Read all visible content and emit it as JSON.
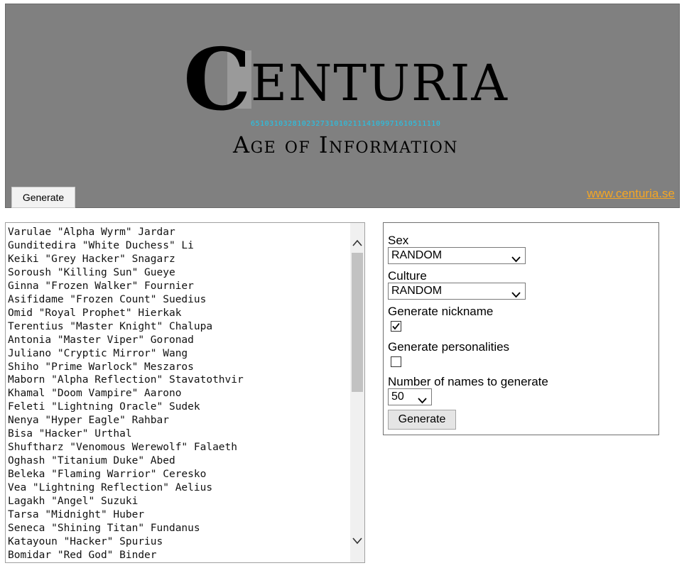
{
  "header": {
    "logo_c": "C",
    "logo_word": "ENTURIA",
    "logo_digits": "65103103281023273101021114109971610511110",
    "subtitle": "Age of Information",
    "generate_label": "Generate",
    "site_link": "www.centuria.se",
    "background": "#808080",
    "link_color": "#f5a623",
    "digits_color": "#1ec8ee"
  },
  "names": [
    "Varulae \"Alpha Wyrm\" Jardar",
    "Gunditedira \"White Duchess\" Li",
    "Keiki \"Grey Hacker\" Snagarz",
    "Soroush \"Killing Sun\" Gueye",
    "Ginna \"Frozen Walker\" Fournier",
    "Asifidame \"Frozen Count\" Suedius",
    "Omid \"Royal Prophet\" Hierkak",
    "Terentius \"Master Knight\" Chalupa",
    "Antonia \"Master Viper\" Goronad",
    "Juliano \"Cryptic Mirror\" Wang",
    "Shiho \"Prime Warlock\" Meszaros",
    "Maborn \"Alpha Reflection\" Stavatothvir",
    "Khamal \"Doom Vampire\" Aarono",
    "Feleti \"Lightning Oracle\" Sudek",
    "Nenya \"Hyper Eagle\" Rahbar",
    "Bisa \"Hacker\" Urthal",
    "Shuftharz \"Venomous Werewolf\" Falaeth",
    "Oghash \"Titanium Duke\" Abed",
    "Beleka \"Flaming Warrior\" Ceresko",
    "Vea \"Lightning Reflection\" Aelius",
    "Lagakh \"Angel\" Suzuki",
    "Tarsa \"Midnight\" Huber",
    "Seneca \"Shining Titan\" Fundanus",
    "Katayoun \"Hacker\" Spurius",
    "Bomidar \"Red God\" Binder"
  ],
  "form": {
    "sex_label": "Sex",
    "sex_value": "RANDOM",
    "culture_label": "Culture",
    "culture_value": "RANDOM",
    "nickname_label": "Generate nickname",
    "nickname_checked": true,
    "personalities_label": "Generate personalities",
    "personalities_checked": false,
    "count_label": "Number of names to generate",
    "count_value": "50",
    "generate_label": "Generate"
  }
}
